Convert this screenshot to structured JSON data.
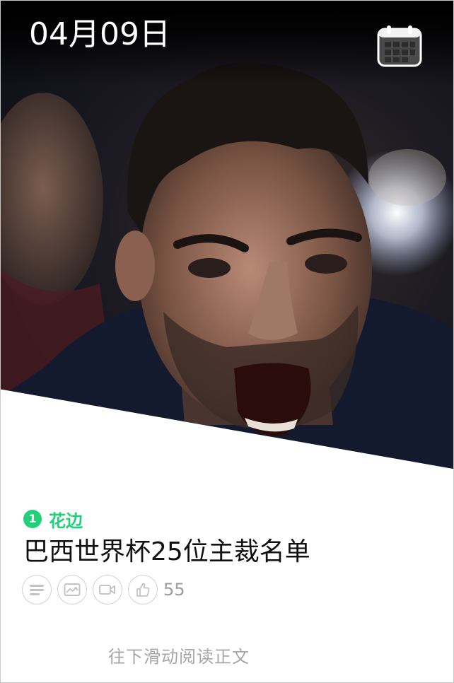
{
  "header": {
    "date": "04月09日",
    "calendar_icon": "calendar-icon"
  },
  "hero": {
    "image_subject": "photo-hero-image"
  },
  "article": {
    "channel_number": "1",
    "channel_name": "花边",
    "title": "巴西世界杯25位主裁名单",
    "likes": "55"
  },
  "tags": [
    {
      "icon": "text-icon"
    },
    {
      "icon": "image-icon"
    },
    {
      "icon": "video-icon"
    },
    {
      "icon": "thumbs-up-icon"
    }
  ],
  "footer": {
    "hint": "往下滑动阅读正文"
  },
  "colors": {
    "accent": "#21d07a",
    "icon_border": "#d2d2d2",
    "muted_text": "#a6a6a6"
  }
}
